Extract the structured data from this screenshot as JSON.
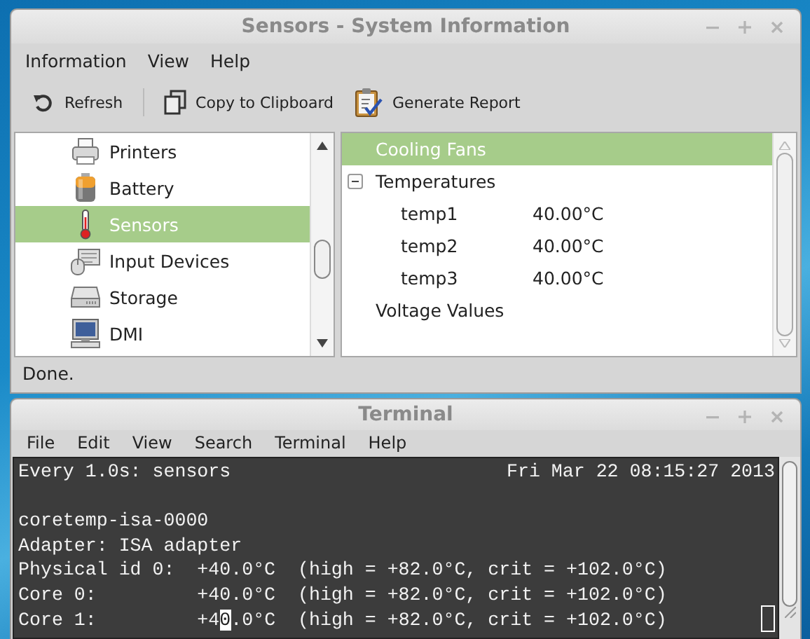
{
  "window": {
    "title": "Sensors - System Information"
  },
  "menu": [
    "Information",
    "View",
    "Help"
  ],
  "toolbar": [
    {
      "label": "Refresh"
    },
    {
      "label": "Copy to Clipboard"
    },
    {
      "label": "Generate Report"
    }
  ],
  "sidebar": {
    "items": [
      {
        "label": "Printers",
        "selected": false
      },
      {
        "label": "Battery",
        "selected": false
      },
      {
        "label": "Sensors",
        "selected": true
      },
      {
        "label": "Input Devices",
        "selected": false
      },
      {
        "label": "Storage",
        "selected": false
      },
      {
        "label": "DMI",
        "selected": false
      }
    ]
  },
  "details": {
    "items": [
      {
        "label": "Cooling Fans",
        "selected": true
      },
      {
        "label": "Temperatures",
        "selected": false,
        "expanded": true,
        "children": [
          {
            "label": "temp1",
            "value": "40.00°C",
            "selected": false
          },
          {
            "label": "temp2",
            "value": "40.00°C",
            "selected": false
          },
          {
            "label": "temp3",
            "value": "40.00°C",
            "selected": false
          }
        ]
      },
      {
        "label": "Voltage Values",
        "selected": false
      }
    ]
  },
  "status_bar": "Done.",
  "terminal": {
    "title": "Terminal",
    "menu": [
      "File",
      "Edit",
      "View",
      "Search",
      "Terminal",
      "Help"
    ],
    "header": {
      "command": "Every 1.0s: sensors",
      "time": "Fri Mar 22 08:15:27 2013"
    },
    "lines": [
      {
        "text": "coretemp-isa-0000"
      },
      {
        "text": "Adapter: ISA adapter"
      },
      {
        "text": "Physical id 0:  +40.0°C  (high = +82.0°C, crit = +102.0°C)"
      },
      {
        "text": "Core 0:         +40.0°C  (high = +82.0°C, crit = +102.0°C)"
      },
      {
        "segments": [
          {
            "text": "Core 1:         +4",
            "inverse": false
          },
          {
            "text": "0",
            "inverse": true
          },
          {
            "text": ".0°C  (high = +82.0°C, crit = +102.0°C)",
            "inverse": false
          }
        ]
      }
    ]
  }
}
